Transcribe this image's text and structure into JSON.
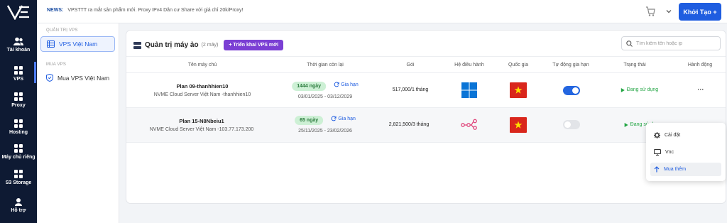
{
  "colors": {
    "rail": "#0e1a33",
    "primary": "#1f5de0",
    "deploy": "#7b3fd4",
    "status_green": "#22a543",
    "flag_red": "#d9261c"
  },
  "rail": {
    "items": [
      {
        "label": "Tài khoản",
        "icon": "users-icon"
      },
      {
        "label": "VPS",
        "icon": "grid-icon"
      },
      {
        "label": "Proxy",
        "icon": "grid-icon"
      },
      {
        "label": "Hosting",
        "icon": "grid-icon"
      },
      {
        "label": "Máy chủ riêng",
        "icon": "grid-icon"
      },
      {
        "label": "S3 Storage",
        "icon": "grid-icon"
      },
      {
        "label": "Hỗ trợ",
        "icon": "support-icon"
      }
    ]
  },
  "topbar": {
    "news_label": "NEWS:",
    "news_text": "VPSTTT ra mắt sản phẩm mới. Proxy IPv4 Dân cư Share với giá chỉ 20k/Proxy!",
    "create_label": "Khởi Tạo +"
  },
  "side": {
    "section1": "QUẢN TRỊ VPS",
    "active_item": "VPS Việt Nam",
    "section2": "MUA VPS",
    "buy_item": "Mua VPS Việt Nam"
  },
  "main": {
    "title": "Quản trị máy ảo",
    "count": "(2 máy)",
    "deploy_label": "+ Triển khai VPS mới",
    "search_placeholder": "Tìm kiếm tên hoặc ip",
    "columns": [
      "Tên máy chủ",
      "Thời gian còn lại",
      "Gói",
      "Hệ điều hành",
      "Quốc gia",
      "Tự động gia hạn",
      "Trạng thái",
      "Hành động"
    ],
    "rows": [
      {
        "name": "Plan 09-thanhhien10",
        "sub": "NVME Cloud Server Việt Nam -thanhhien10",
        "days": "1444 ngày",
        "renew": "Gia hạn",
        "dates": "03/01/2025 - 03/12/2029",
        "package": "517,000/1 tháng",
        "os": "windows-icon",
        "country_icon": "vietnam-flag-icon",
        "auto_renew": true,
        "status": "Đang sử dụng",
        "action": "···"
      },
      {
        "name": "Plan 15-N8Nbeiu1",
        "sub": "NVME Cloud Server Việt Nam -103.77.173.200",
        "days": "65 ngày",
        "renew": "Gia hạn",
        "dates": "25/11/2025 - 23/02/2026",
        "package": "2,821,500/3 tháng",
        "os": "n8n-icon",
        "country_icon": "vietnam-flag-icon",
        "auto_renew": false,
        "status": "Đang sử d",
        "action": ""
      }
    ]
  },
  "menu": {
    "items": [
      {
        "label": "Cài đặt",
        "icon": "gear-icon"
      },
      {
        "label": "Vnc",
        "icon": "monitor-icon"
      },
      {
        "label": "Mua thêm",
        "icon": "arrow-up-icon"
      }
    ]
  }
}
